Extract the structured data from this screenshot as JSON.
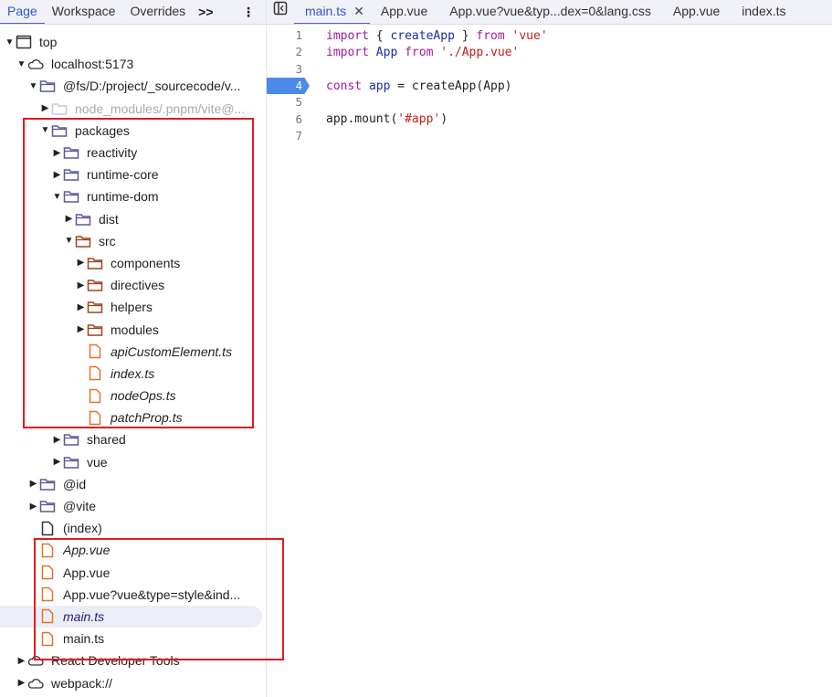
{
  "left_tabs": [
    {
      "label": "Page",
      "active": true
    },
    {
      "label": "Workspace"
    },
    {
      "label": "Overrides"
    }
  ],
  "more_label": ">>",
  "kebab_label": "⋮",
  "tree": [
    {
      "level": 0,
      "arrow": "down",
      "icon": "frame",
      "label": "top"
    },
    {
      "level": 1,
      "arrow": "down",
      "icon": "cloud",
      "label": "localhost:5173"
    },
    {
      "level": 2,
      "arrow": "down",
      "icon": "folder",
      "label": "@fs/D:/project/_sourcecode/v..."
    },
    {
      "level": 3,
      "arrow": "right",
      "icon": "folder-dim",
      "label": "node_modules/.pnpm/vite@...",
      "dim": true
    },
    {
      "level": 3,
      "arrow": "down",
      "icon": "folder",
      "label": "packages"
    },
    {
      "level": 4,
      "arrow": "right",
      "icon": "folder",
      "label": "reactivity"
    },
    {
      "level": 4,
      "arrow": "right",
      "icon": "folder",
      "label": "runtime-core"
    },
    {
      "level": 4,
      "arrow": "down",
      "icon": "folder",
      "label": "runtime-dom"
    },
    {
      "level": 5,
      "arrow": "right",
      "icon": "folder",
      "label": "dist"
    },
    {
      "level": 5,
      "arrow": "down",
      "icon": "folder-src",
      "label": "src"
    },
    {
      "level": 6,
      "arrow": "right",
      "icon": "folder-src",
      "label": "components"
    },
    {
      "level": 6,
      "arrow": "right",
      "icon": "folder-src",
      "label": "directives"
    },
    {
      "level": 6,
      "arrow": "right",
      "icon": "folder-src",
      "label": "helpers"
    },
    {
      "level": 6,
      "arrow": "right",
      "icon": "folder-src",
      "label": "modules"
    },
    {
      "level": 6,
      "arrow": "none",
      "icon": "file-orange",
      "label": "apiCustomElement.ts",
      "italic": true
    },
    {
      "level": 6,
      "arrow": "none",
      "icon": "file-orange",
      "label": "index.ts",
      "italic": true
    },
    {
      "level": 6,
      "arrow": "none",
      "icon": "file-orange",
      "label": "nodeOps.ts",
      "italic": true
    },
    {
      "level": 6,
      "arrow": "none",
      "icon": "file-orange",
      "label": "patchProp.ts",
      "italic": true
    },
    {
      "level": 4,
      "arrow": "right",
      "icon": "folder",
      "label": "shared"
    },
    {
      "level": 4,
      "arrow": "right",
      "icon": "folder",
      "label": "vue"
    },
    {
      "level": 2,
      "arrow": "right",
      "icon": "folder",
      "label": "@id"
    },
    {
      "level": 2,
      "arrow": "right",
      "icon": "folder",
      "label": "@vite"
    },
    {
      "level": 2,
      "arrow": "none",
      "icon": "file",
      "label": "(index)"
    },
    {
      "level": 2,
      "arrow": "none",
      "icon": "file-orange",
      "label": "App.vue",
      "italic": true
    },
    {
      "level": 2,
      "arrow": "none",
      "icon": "file-orange",
      "label": "App.vue"
    },
    {
      "level": 2,
      "arrow": "none",
      "icon": "file-orange",
      "label": "App.vue?vue&type=style&ind..."
    },
    {
      "level": 2,
      "arrow": "none",
      "icon": "file-orange",
      "label": "main.ts",
      "italic": true,
      "selected": true
    },
    {
      "level": 2,
      "arrow": "none",
      "icon": "file-orange",
      "label": "main.ts"
    },
    {
      "level": 1,
      "arrow": "right",
      "icon": "cloud",
      "label": "React Developer Tools"
    },
    {
      "level": 1,
      "arrow": "right",
      "icon": "cloud",
      "label": "webpack://"
    }
  ],
  "editor_tabs": [
    {
      "label": "main.ts",
      "active": true,
      "closable": true
    },
    {
      "label": "App.vue"
    },
    {
      "label": "App.vue?vue&typ...dex=0&lang.css"
    },
    {
      "label": "App.vue"
    },
    {
      "label": "index.ts"
    }
  ],
  "code": [
    {
      "n": "1",
      "tokens": [
        [
          "kw",
          "import"
        ],
        [
          "pl",
          " { "
        ],
        [
          "id",
          "createApp"
        ],
        [
          "pl",
          " } "
        ],
        [
          "kw",
          "from"
        ],
        [
          "pl",
          " "
        ],
        [
          "str",
          "'vue'"
        ]
      ]
    },
    {
      "n": "2",
      "tokens": [
        [
          "kw",
          "import"
        ],
        [
          "pl",
          " "
        ],
        [
          "id",
          "App"
        ],
        [
          "pl",
          " "
        ],
        [
          "kw",
          "from"
        ],
        [
          "pl",
          " "
        ],
        [
          "str",
          "'./App.vue'"
        ]
      ]
    },
    {
      "n": "3",
      "tokens": []
    },
    {
      "n": "4",
      "breakpoint": true,
      "tokens": [
        [
          "kw",
          "const"
        ],
        [
          "pl",
          " "
        ],
        [
          "id",
          "app"
        ],
        [
          "pl",
          " = createApp(App)"
        ]
      ]
    },
    {
      "n": "5",
      "tokens": []
    },
    {
      "n": "6",
      "tokens": [
        [
          "pl",
          "app.mount("
        ],
        [
          "str",
          "'#app'"
        ],
        [
          "pl",
          ")"
        ]
      ]
    },
    {
      "n": "7",
      "tokens": []
    }
  ],
  "colors": {
    "accent": "#5a5ad6",
    "breakpoint": "#4b8ae8",
    "highlight_box": "#e31b23",
    "folder": "#5a5a9a",
    "folder_src": "#a0431c",
    "file_orange": "#e8702a"
  }
}
